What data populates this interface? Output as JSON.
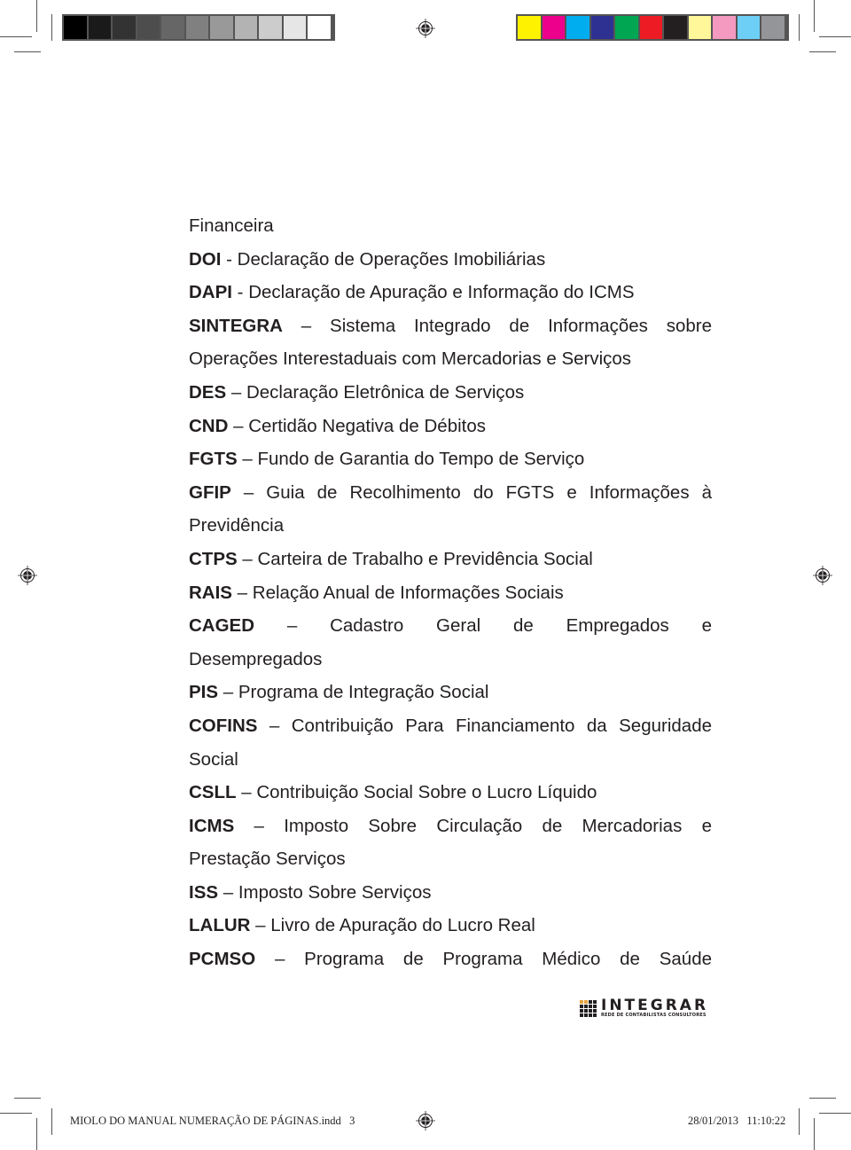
{
  "printer_marks": {
    "grayscale_bar": [
      "#000000",
      "#1a1a1a",
      "#333333",
      "#4d4d4d",
      "#666666",
      "#808080",
      "#999999",
      "#b3b3b3",
      "#cccccc",
      "#e6e6e6",
      "#ffffff"
    ],
    "color_bar": [
      "#fff200",
      "#ec008c",
      "#00aeef",
      "#2e3192",
      "#00a651",
      "#ed1c24",
      "#231f20",
      "#fff799",
      "#f49ac1",
      "#6dcff6",
      "#939598"
    ],
    "registration_icon": "registration-target-icon"
  },
  "document": {
    "lines": [
      {
        "abbr": "",
        "sep": "",
        "text": "Financeira",
        "justify": false
      },
      {
        "abbr": "DOI",
        "sep": " - ",
        "text": "Declaração de Operações Imobiliárias",
        "justify": false
      },
      {
        "abbr": "DAPI",
        "sep": " - ",
        "text": "Declaração de Apuração e Informação do ICMS",
        "justify": false
      },
      {
        "abbr": "SINTEGRA",
        "sep": " – ",
        "text": "Sistema Integrado de Informações sobre",
        "justify": true
      },
      {
        "abbr": "",
        "sep": "",
        "text": "Operações Interestaduais com Mercadorias e Serviços",
        "justify": false
      },
      {
        "abbr": "DES",
        "sep": " – ",
        "text": "Declaração Eletrônica de Serviços",
        "justify": false
      },
      {
        "abbr": "CND",
        "sep": " – ",
        "text": "Certidão Negativa de Débitos",
        "justify": false
      },
      {
        "abbr": "FGTS",
        "sep": " – ",
        "text": "Fundo de Garantia do Tempo de Serviço",
        "justify": false
      },
      {
        "abbr": "GFIP",
        "sep": " – ",
        "text": "Guia de Recolhimento do FGTS e Informações à",
        "justify": true
      },
      {
        "abbr": "",
        "sep": "",
        "text": "Previdência",
        "justify": false
      },
      {
        "abbr": "CTPS",
        "sep": " – ",
        "text": "Carteira de Trabalho e Previdência Social",
        "justify": false
      },
      {
        "abbr": "RAIS",
        "sep": " – ",
        "text": "Relação Anual de Informações Sociais",
        "justify": false
      },
      {
        "abbr": "CAGED",
        "sep": " – ",
        "text": "Cadastro Geral de Empregados e",
        "justify": true
      },
      {
        "abbr": "",
        "sep": "",
        "text": "Desempregados",
        "justify": false
      },
      {
        "abbr": "PIS",
        "sep": " – ",
        "text": "Programa de Integração Social",
        "justify": false
      },
      {
        "abbr": "COFINS",
        "sep": " – ",
        "text": "Contribuição Para Financiamento da Seguridade",
        "justify": true
      },
      {
        "abbr": "",
        "sep": "",
        "text": "Social",
        "justify": false
      },
      {
        "abbr": "CSLL",
        "sep": " – ",
        "text": "Contribuição Social Sobre o Lucro Líquido",
        "justify": false
      },
      {
        "abbr": "ICMS",
        "sep": " – ",
        "text": "Imposto Sobre Circulação de Mercadorias e",
        "justify": true
      },
      {
        "abbr": "",
        "sep": "",
        "text": "Prestação Serviços",
        "justify": false
      },
      {
        "abbr": "ISS",
        "sep": " – ",
        "text": "Imposto Sobre Serviços",
        "justify": false
      },
      {
        "abbr": "LALUR",
        "sep": " – ",
        "text": "Livro de Apuração do Lucro Real",
        "justify": false
      },
      {
        "abbr": "PCMSO",
        "sep": " – ",
        "text": "Programa de Programa Médico de Saúde",
        "justify": true
      }
    ]
  },
  "logo": {
    "name": "INTEGRAR",
    "tagline": "REDE DE CONTABILISTAS CONSULTORES",
    "accent_color": "#e8a33a"
  },
  "slug": {
    "filename": "MIOLO DO MANUAL NUMERAÇÃO DE PÁGINAS.indd",
    "page": "3",
    "date": "28/01/2013",
    "time": "11:10:22"
  }
}
